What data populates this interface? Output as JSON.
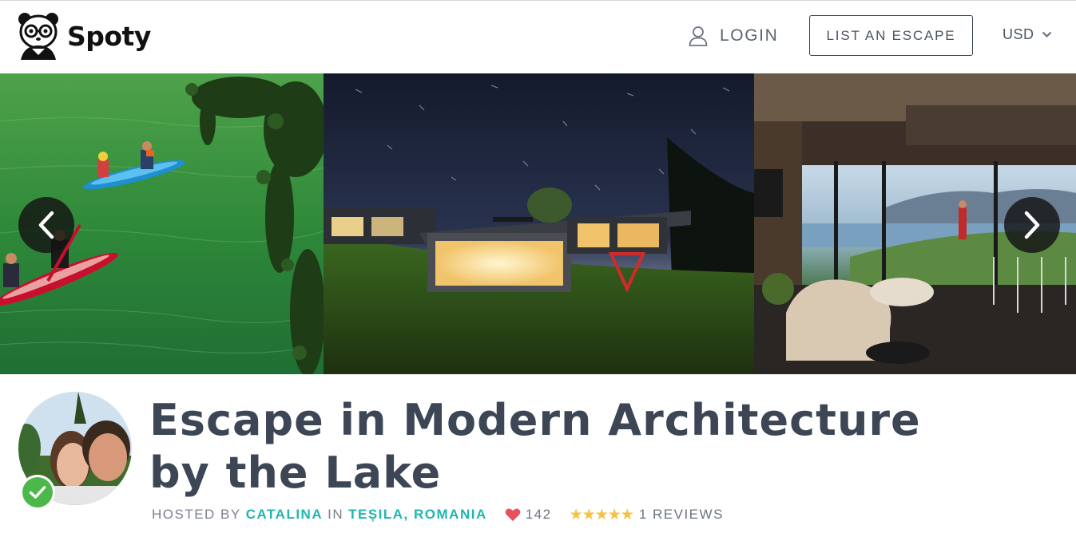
{
  "header": {
    "brand": "Spoty",
    "login_label": "LOGIN",
    "list_escape_label": "LIST AN ESCAPE",
    "currency": "USD",
    "icons": {
      "logo": "panda-logo-icon",
      "user": "user-icon",
      "currency_chevron": "chevron-down-icon"
    }
  },
  "gallery": {
    "icons": {
      "prev": "chevron-left-icon",
      "next": "chevron-right-icon"
    }
  },
  "listing": {
    "title": "Escape in Modern Architecture by the Lake",
    "hosted_by_label": "HOSTED BY",
    "host_name": "CATALINA",
    "in_label": "IN",
    "location": "TEȘILA, ROMANIA",
    "likes": "142",
    "rating_stars": 5,
    "reviews_label": "1 REVIEWS",
    "icons": {
      "verified": "check-badge-icon",
      "heart": "heart-icon",
      "star": "star-icon"
    }
  },
  "colors": {
    "accent": "#20b5b0",
    "heading": "#3c4654",
    "heart": "#e8505b",
    "star": "#f5c242",
    "verified": "#4db84a"
  }
}
